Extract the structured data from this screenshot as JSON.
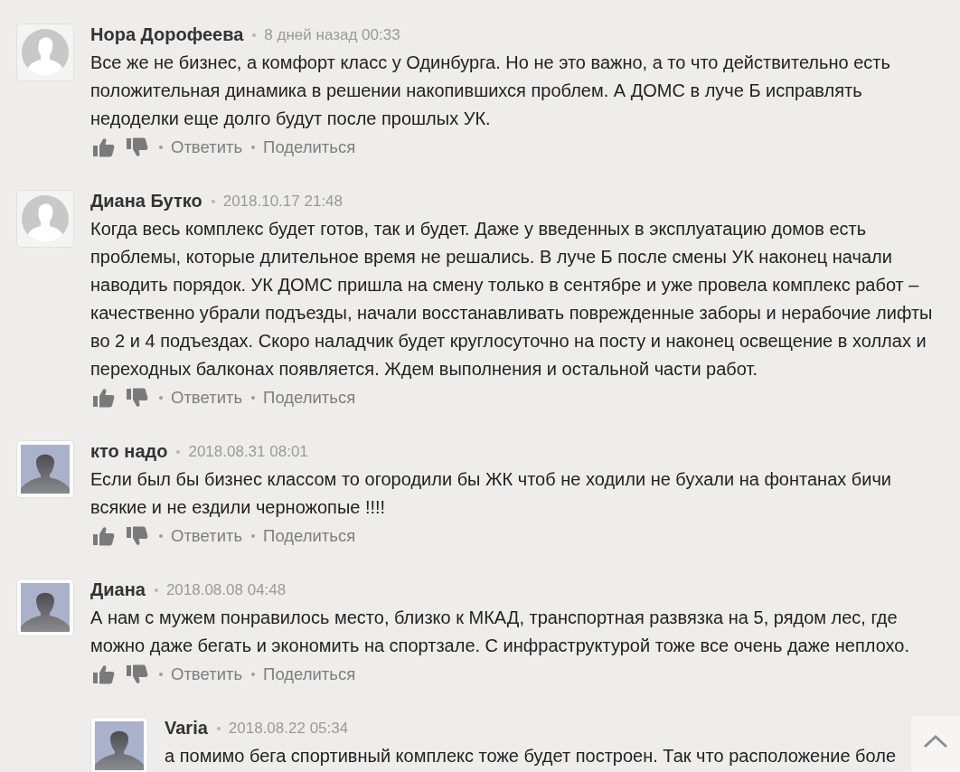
{
  "comments": [
    {
      "author": "Нора Дорофеева",
      "time": "8 дней назад 00:33",
      "kind": "placeholder",
      "text": "Все же не бизнес, а комфорт класс у Одинбурга. Но не это важно, а то что действительно есть положительная динамика в решении накопившихся проблем. А ДОМС в луче Б исправлять недоделки еще долго будут после прошлых УК.",
      "actions": [
        "Ответить",
        "Поделиться"
      ]
    },
    {
      "author": "Диана Бутко",
      "time": "2018.10.17 21:48",
      "kind": "placeholder",
      "text": "Когда весь комплекс будет готов, так и будет. Даже у введенных в эксплуатацию домов есть проблемы, которые длительное время не решались. В луче Б после смены УК наконец начали наводить порядок. УК ДОМС пришла на смену только в сентябре и уже провела комплекс работ – качественно убрали подъезды, начали восстанавливать поврежденные заборы и нерабочие лифты во 2 и 4 подъездах. Скоро наладчик будет круглосуточно на посту и наконец освещение в холлах и переходных балконах появляется. Ждем выполнения и остальной части работ.",
      "actions": [
        "Ответить",
        "Поделиться"
      ]
    },
    {
      "author": "кто надо",
      "time": "2018.08.31 08:01",
      "kind": "silhouette",
      "text": "Если был бы бизнес классом то огородили бы ЖК чтоб не ходили не бухали на фонтанах бичи всякие и не ездили черножопые !!!!",
      "actions": [
        "Ответить",
        "Поделиться"
      ]
    },
    {
      "author": "Диана",
      "time": "2018.08.08 04:48",
      "kind": "silhouette",
      "text": "А нам с мужем понравилось место, близко к МКАД, транспортная развязка на 5, рядом лес, где можно даже бегать и экономить на спортзале. С инфраструктурой тоже все очень даже неплохо.",
      "actions": [
        "Ответить",
        "Поделиться"
      ],
      "children": [
        {
          "author": "Varia",
          "time": "2018.08.22 05:34",
          "kind": "silhouette",
          "text": "а помимо бега спортивный комплекс тоже будет построен. Так что расположение боле"
        }
      ]
    }
  ]
}
